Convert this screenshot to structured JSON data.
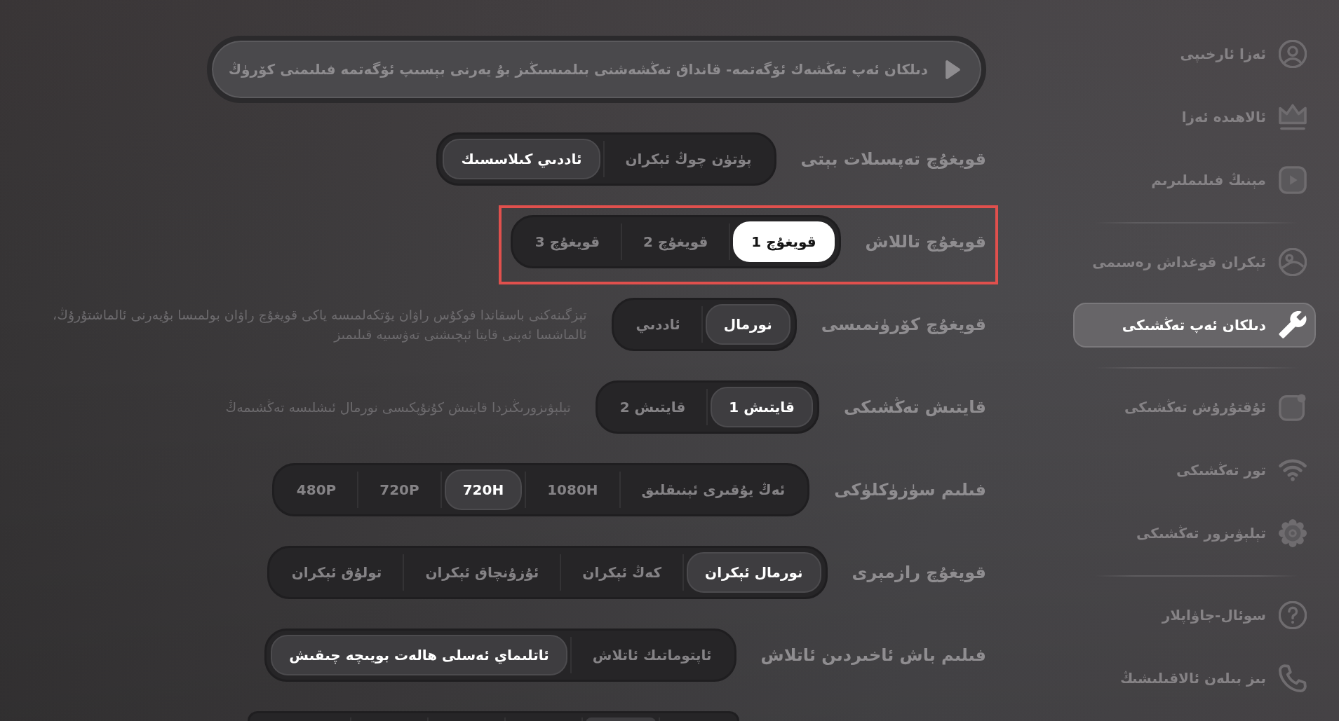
{
  "sidebar": {
    "groups": [
      {
        "items": [
          {
            "label": "ئەزا ئارخىپى",
            "selected": false
          },
          {
            "label": "ئالاھىدە ئەزا",
            "selected": false
          },
          {
            "label": "مېنىڭ فىلىملىرىم",
            "selected": false
          }
        ]
      },
      {
        "items": [
          {
            "label": "ئېكران قوغداش رەسىمى",
            "selected": false
          },
          {
            "label": "دىلكان ئەپ تەڭشىكى",
            "selected": true
          }
        ]
      },
      {
        "items": [
          {
            "label": "ئۇقتۇرۇش تەڭشىكى",
            "selected": false
          },
          {
            "label": "تور تەڭشىكى",
            "selected": false
          },
          {
            "label": "تېلېۋىزور تەڭشىكى",
            "selected": false
          }
        ]
      },
      {
        "items": [
          {
            "label": "سوئال-جاۋاپلار",
            "selected": false
          },
          {
            "label": "بىز بىلەن ئالاقىلىشىڭ",
            "selected": false
          }
        ]
      }
    ]
  },
  "banner": {
    "text": "دىلكان ئەپ تەڭشەك ئۆگەتمە- قانداق تەڭشەشنى بىلمىسىڭىز بۇ يەرنى بېسىپ ئۆگەتمە فىلىمنى كۆرۈڭ"
  },
  "settings": [
    {
      "label": "قويغۇچ تەپسىلات بېتى",
      "highlighted": false,
      "focused": false,
      "options": [
        {
          "label": "پۈتۈن چوڭ ئېكران",
          "selected": false
        },
        {
          "label": "ئاددىي كىلاسسىك",
          "selected": true
        }
      ]
    },
    {
      "label": "قويغۇچ تاللاش",
      "highlighted": true,
      "focused": true,
      "options": [
        {
          "label": "قويغۇچ 1",
          "selected": true
        },
        {
          "label": "قويغۇچ 2",
          "selected": false
        },
        {
          "label": "قويغۇچ 3",
          "selected": false
        }
      ]
    },
    {
      "label": "قويغۇچ كۆرۈنمىسى",
      "highlighted": false,
      "focused": false,
      "options": [
        {
          "label": "نورمال",
          "selected": true
        },
        {
          "label": "ئاددىي",
          "selected": false
        }
      ],
      "note": "تېزگىنەكنى باسقاندا فوكۇس راۋان يۆتكەلمىسە ياكى قويغۇچ راۋان بولمىسا بۇيەرنى ئالماشتۇرۇڭ، ئالماشسا ئەپنى قايتا ئېچىشنى تەۋسىيە قىلىمىز"
    },
    {
      "label": "قايتىش تەڭشىكى",
      "highlighted": false,
      "focused": false,
      "options": [
        {
          "label": "قايتىش 1",
          "selected": true
        },
        {
          "label": "قايتىش 2",
          "selected": false
        }
      ],
      "note": "تېلېۋىزورىڭىزدا قايتىش كۇنۇپكىسى نورمال ئىشلىسە تەڭشىمەڭ"
    },
    {
      "label": "فىلىم سۈزۈكلۈكى",
      "highlighted": false,
      "focused": false,
      "options": [
        {
          "label": "ئەڭ يۇقىرى ئېنىقلىق",
          "selected": false
        },
        {
          "label": "1080H",
          "selected": false
        },
        {
          "label": "720H",
          "selected": true
        },
        {
          "label": "720P",
          "selected": false
        },
        {
          "label": "480P",
          "selected": false
        }
      ]
    },
    {
      "label": "قويغۇچ رازمېرى",
      "highlighted": false,
      "focused": false,
      "options": [
        {
          "label": "نورمال ئېكران",
          "selected": true
        },
        {
          "label": "كەڭ ئېكران",
          "selected": false
        },
        {
          "label": "ئۇزۇنچاق ئېكران",
          "selected": false
        },
        {
          "label": "تولۇق ئېكران",
          "selected": false
        }
      ]
    },
    {
      "label": "فىلىم باش ئاخىردىن ئاتلاش",
      "highlighted": false,
      "focused": false,
      "options": [
        {
          "label": "ئاپتوماتىك ئاتلاش",
          "selected": false
        },
        {
          "label": "ئاتلىماي ئەسلى ھالەت بويىچە چىقىش",
          "selected": true
        }
      ]
    }
  ],
  "partial_row": {
    "options": [
      {
        "selected": false
      },
      {
        "selected": true
      },
      {
        "selected": false
      },
      {
        "selected": false
      },
      {
        "selected": false
      },
      {
        "selected": false
      }
    ]
  }
}
